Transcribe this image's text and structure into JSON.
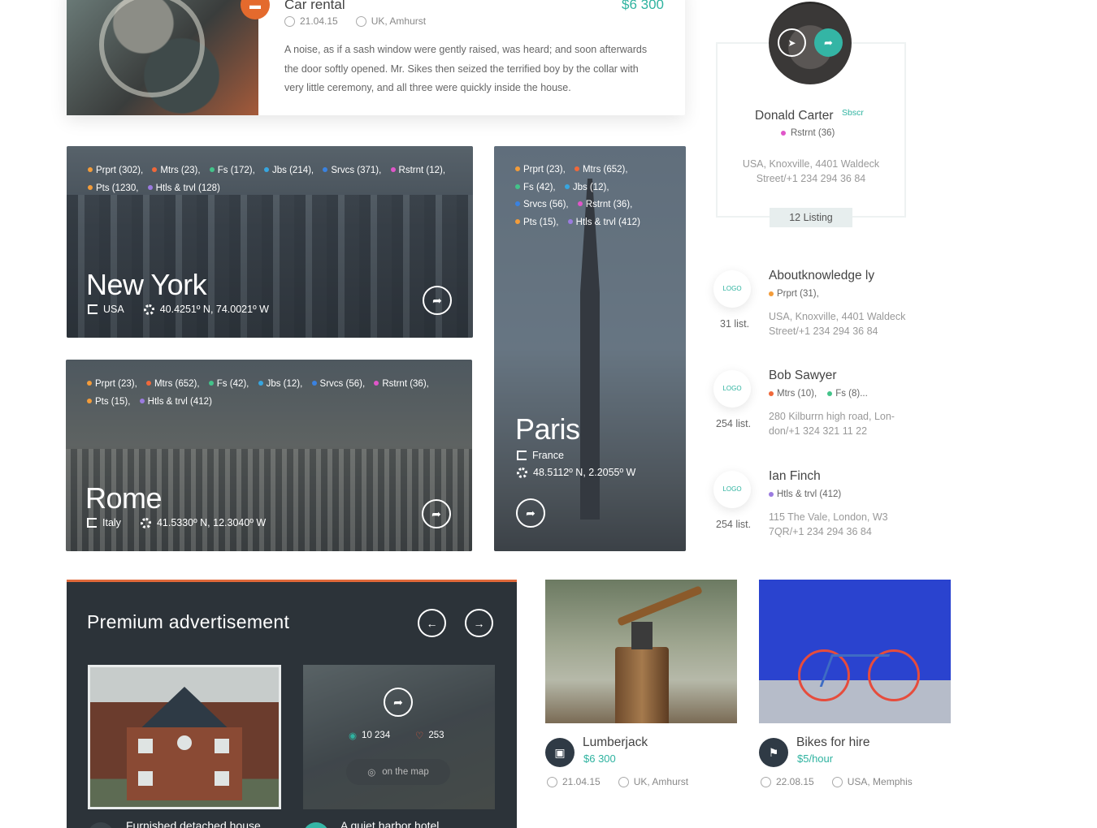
{
  "top_listing": {
    "title": "Car rental",
    "price": "$6 300",
    "date": "21.04.15",
    "location": "UK, Amhurst",
    "description": "A noise, as if a sash window were gently raised, was heard; and soon afterwards the door softly opened. Mr. Sikes then seized the terrified boy by the collar with very little ceremony, and all three were quickly inside the house."
  },
  "cities": {
    "new_york": {
      "name": "New York",
      "country": "USA",
      "coords": "40.4251º N, 74.0021º W",
      "tags": [
        {
          "label": "Prprt (302),",
          "color": "#f39c3a"
        },
        {
          "label": "Mtrs (23),",
          "color": "#f0683a"
        },
        {
          "label": "Fs (172),",
          "color": "#43c38a"
        },
        {
          "label": "Jbs (214),",
          "color": "#37a6e0"
        },
        {
          "label": "Srvcs (371),",
          "color": "#3a82e0"
        },
        {
          "label": "Rstrnt (12),",
          "color": "#e056c9"
        },
        {
          "label": "Pts (1230,",
          "color": "#f39c3a"
        },
        {
          "label": "Htls & trvl (128)",
          "color": "#9b7be0"
        }
      ]
    },
    "rome": {
      "name": "Rome",
      "country": "Italy",
      "coords": "41.5330º N, 12.3040º W",
      "tags": [
        {
          "label": "Prprt (23),",
          "color": "#f39c3a"
        },
        {
          "label": "Mtrs (652),",
          "color": "#f0683a"
        },
        {
          "label": "Fs (42),",
          "color": "#43c38a"
        },
        {
          "label": "Jbs (12),",
          "color": "#37a6e0"
        },
        {
          "label": "Srvcs (56),",
          "color": "#3a82e0"
        },
        {
          "label": "Rstrnt (36),",
          "color": "#e056c9"
        },
        {
          "label": "Pts (15),",
          "color": "#f39c3a"
        },
        {
          "label": "Htls & trvl (412)",
          "color": "#9b7be0"
        }
      ]
    },
    "paris": {
      "name": "Paris",
      "country": "France",
      "coords": "48.5112º N, 2.2055º W",
      "tags": [
        {
          "label": "Prprt (23),",
          "color": "#f39c3a"
        },
        {
          "label": "Mtrs (652),",
          "color": "#f0683a"
        },
        {
          "label": "Fs (42),",
          "color": "#43c38a"
        },
        {
          "label": "Jbs (12),",
          "color": "#37a6e0"
        },
        {
          "label": "Srvcs (56),",
          "color": "#3a82e0"
        },
        {
          "label": "Rstrnt (36),",
          "color": "#e056c9"
        },
        {
          "label": "Pts (15),",
          "color": "#f39c3a"
        },
        {
          "label": "Htls & trvl (412)",
          "color": "#9b7be0"
        }
      ]
    }
  },
  "profile": {
    "name": "Donald Carter",
    "subscribe": "Sbscr",
    "category": "Rstrnt (36)",
    "category_color": "#e056c9",
    "address": "USA, Knoxville, 4401 Waldeck Street/+1 234 294 36 84",
    "listing": "12 Listing"
  },
  "agencies": [
    {
      "logo": "LOGO",
      "count": "31 list.",
      "name": "Aboutknowledge ly",
      "cats": [
        {
          "label": "Prprt (31),",
          "color": "#f39c3a"
        }
      ],
      "address": "USA, Knoxville, 4401 Waldeck Street/+1 234 294 36 84"
    },
    {
      "logo": "LOGO",
      "count": "254 list.",
      "name": "Bob Sawyer",
      "cats": [
        {
          "label": "Mtrs (10),",
          "color": "#f0683a"
        },
        {
          "label": "Fs (8)...",
          "color": "#43c38a"
        }
      ],
      "address": "280 Kilburrn high road, Lon-don/+1 324 321 11 22"
    },
    {
      "logo": "LOGO",
      "count": "254 list.",
      "name": "Ian Finch",
      "cats": [
        {
          "label": "Htls & trvl (412)",
          "color": "#9b7be0"
        }
      ],
      "address": "115 The Vale, London, W3 7QR/+1 234 294 36 84"
    }
  ],
  "premium": {
    "title": "Premium advertisement",
    "views": "10 234",
    "likes": "253",
    "map_label": "on the map",
    "card1_title": "Furnished detached house",
    "card2_title": "A quiet harbor hotel"
  },
  "bottom_listings": [
    {
      "title": "Lumberjack",
      "price": "$6 300",
      "date": "21.04.15",
      "location": "UK, Amhurst"
    },
    {
      "title": "Bikes for hire",
      "price": "$5/hour",
      "date": "22.08.15",
      "location": "USA, Memphis"
    }
  ],
  "colors": {
    "accent": "#2fb3a0",
    "orange": "#e0693a",
    "dark": "#2c3339"
  }
}
